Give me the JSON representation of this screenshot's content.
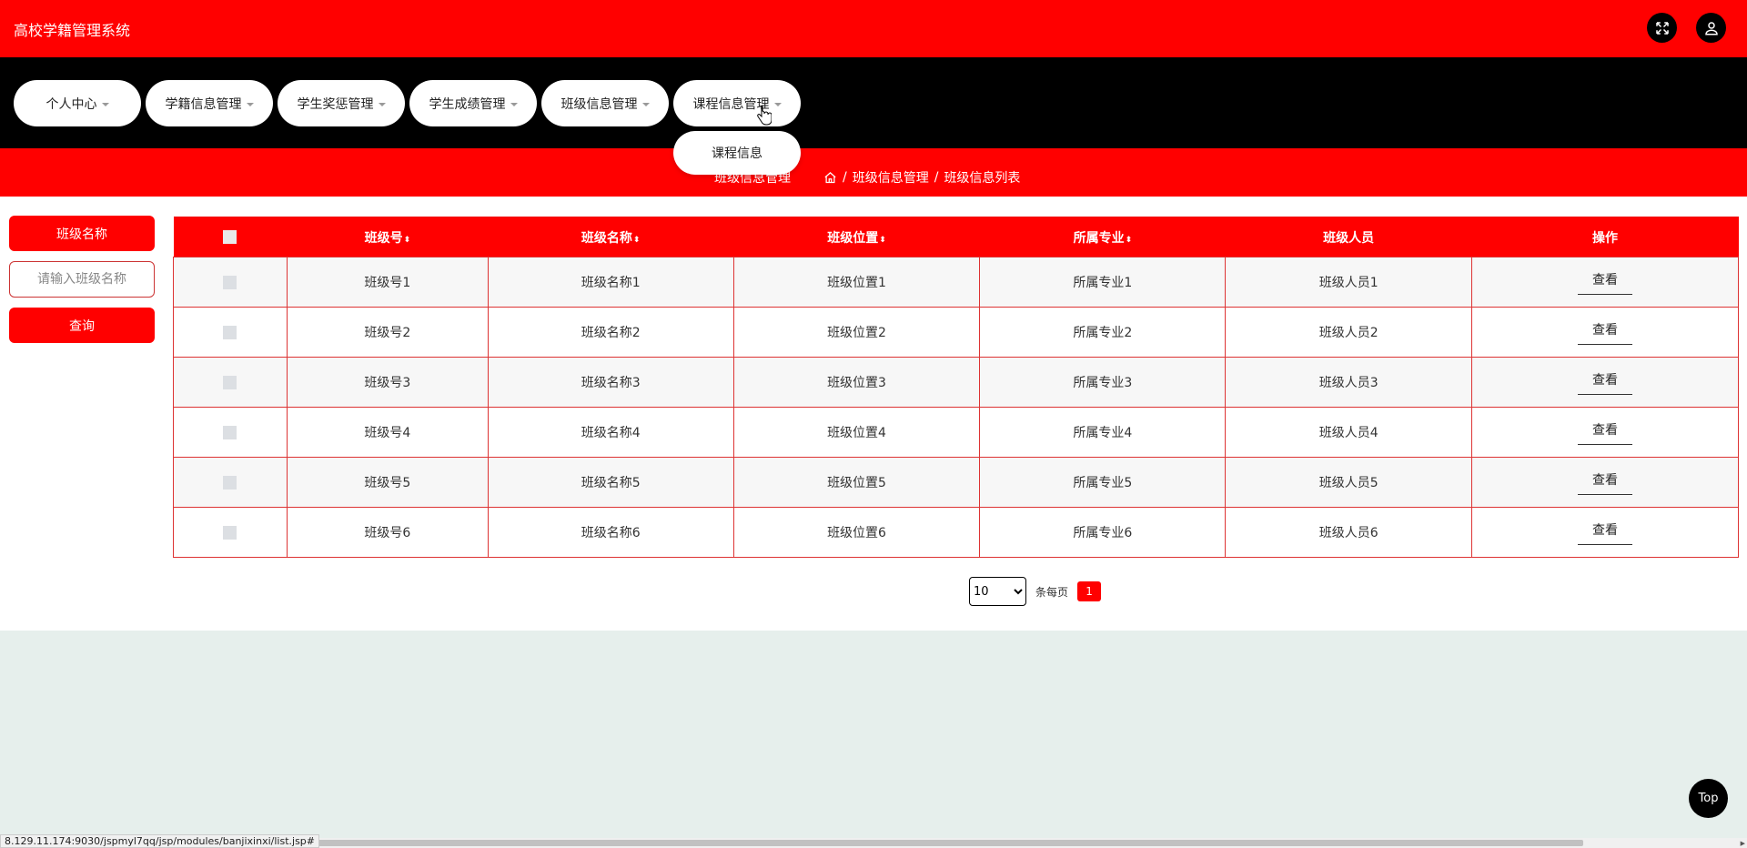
{
  "app": {
    "title": "高校学籍管理系统"
  },
  "nav": {
    "items": [
      {
        "label": "个人中心"
      },
      {
        "label": "学籍信息管理"
      },
      {
        "label": "学生奖惩管理"
      },
      {
        "label": "学生成绩管理"
      },
      {
        "label": "班级信息管理"
      },
      {
        "label": "课程信息管理"
      }
    ],
    "dropdown_item": "课程信息"
  },
  "breadcrumb": {
    "title": "班级信息管理",
    "path": [
      "班级信息管理",
      "班级信息列表"
    ],
    "separator": "/"
  },
  "search": {
    "field_label": "班级名称",
    "placeholder": "请输入班级名称",
    "button": "查询"
  },
  "table": {
    "headers": [
      "班级号",
      "班级名称",
      "班级位置",
      "所属专业",
      "班级人员",
      "操作"
    ],
    "sort_icon": "⬍",
    "action_label": "查看",
    "rows": [
      {
        "no": "班级号1",
        "name": "班级名称1",
        "location": "班级位置1",
        "major": "所属专业1",
        "members": "班级人员1"
      },
      {
        "no": "班级号2",
        "name": "班级名称2",
        "location": "班级位置2",
        "major": "所属专业2",
        "members": "班级人员2"
      },
      {
        "no": "班级号3",
        "name": "班级名称3",
        "location": "班级位置3",
        "major": "所属专业3",
        "members": "班级人员3"
      },
      {
        "no": "班级号4",
        "name": "班级名称4",
        "location": "班级位置4",
        "major": "所属专业4",
        "members": "班级人员4"
      },
      {
        "no": "班级号5",
        "name": "班级名称5",
        "location": "班级位置5",
        "major": "所属专业5",
        "members": "班级人员5"
      },
      {
        "no": "班级号6",
        "name": "班级名称6",
        "location": "班级位置6",
        "major": "所属专业6",
        "members": "班级人员6"
      }
    ]
  },
  "pagination": {
    "page_size": "10",
    "per_page_label": "条每页",
    "current_page": "1"
  },
  "back_to_top": "Top",
  "status_bar": {
    "url": "8.129.11.174:9030/jspmyl7qq/jsp/modules/banjixinxi/list.jsp#"
  },
  "colors": {
    "primary": "#ff0000",
    "nav_bg": "#000000",
    "page_bg": "#e6efec"
  },
  "icons": {
    "fullscreen": "fullscreen-icon",
    "user": "user-icon",
    "home": "home-icon"
  }
}
